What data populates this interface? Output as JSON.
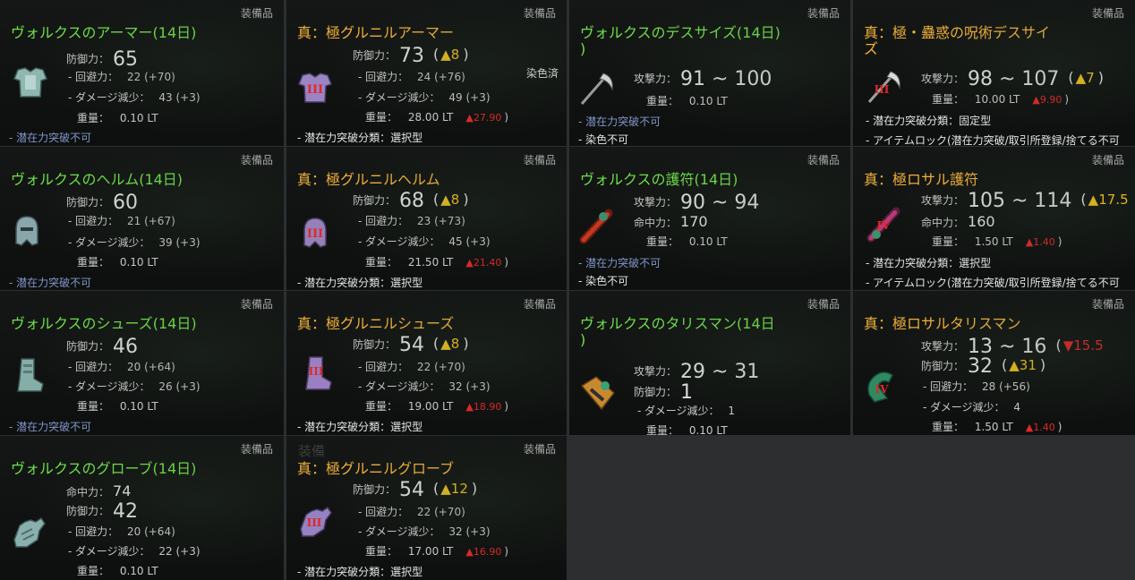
{
  "common": {
    "equip_label": "装備品",
    "defense_label": "防御力：",
    "evasion_label": "- 回避力：",
    "dmgred_label": "- ダメージ減少：",
    "weight_label": "重量：",
    "attack_label": "攻撃力：",
    "accuracy_label": "命中力：",
    "potential_no": "- 潜在力突破不可",
    "potential_select": "- 潜在力突破分類：選択型",
    "potential_fixed": "- 潜在力突破分類：固定型",
    "item_lock": "- アイテムロック(潜在力突破/取引所登録/捨てる不可",
    "dye_no": "- 染色不可",
    "dye_done": "染色済",
    "ghost_text": "装備"
  },
  "armor": {
    "vol_armor": {
      "title": "ヴォルクスのアーマー(14日)",
      "defense": "65",
      "evasion": "22 (+70)",
      "dmgred": "43 (+3)",
      "weight": "0.10 LT"
    },
    "gru_armor": {
      "title": "真：極グルニルアーマー",
      "defense": "73",
      "up": "▲8",
      "up_close": ")",
      "evasion": "24 (+76)",
      "dmgred": "49 (+3)",
      "weight": "28.00 LT",
      "weight_diff": "▲27.90",
      "numeral": "III"
    },
    "vol_helm": {
      "title": "ヴォルクスのヘルム(14日)",
      "defense": "60",
      "evasion": "21 (+67)",
      "dmgred": "39 (+3)",
      "weight": "0.10 LT"
    },
    "gru_helm": {
      "title": "真：極グルニルヘルム",
      "defense": "68",
      "up": "▲8",
      "up_close": ")",
      "evasion": "23 (+73)",
      "dmgred": "45 (+3)",
      "weight": "21.50 LT",
      "weight_diff": "▲21.40",
      "numeral": "III"
    },
    "vol_shoes": {
      "title": "ヴォルクスのシューズ(14日)",
      "defense": "46",
      "evasion": "20 (+64)",
      "dmgred": "26 (+3)",
      "weight": "0.10 LT"
    },
    "gru_shoes": {
      "title": "真：極グルニルシューズ",
      "defense": "54",
      "up": "▲8",
      "up_close": ")",
      "evasion": "22 (+70)",
      "dmgred": "32 (+3)",
      "weight": "19.00 LT",
      "weight_diff": "▲18.90",
      "numeral": "III"
    },
    "vol_glove": {
      "title": "ヴォルクスのグローブ(14日)",
      "accuracy": "74",
      "defense": "42",
      "evasion": "20 (+64)",
      "dmgred": "22 (+3)",
      "weight": "0.10 LT"
    },
    "gru_glove": {
      "title": "真：極グルニルグローブ",
      "defense": "54",
      "up": "▲12",
      "up_close": ")",
      "evasion": "22 (+70)",
      "dmgred": "32 (+3)",
      "weight": "17.00 LT",
      "weight_diff": "▲16.90",
      "numeral": "III"
    }
  },
  "weapons": {
    "vol_scythe": {
      "title": "ヴォルクスのデスサイズ(14日)",
      "title2": ")",
      "attack": "91 ~ 100",
      "weight": "0.10 LT"
    },
    "kyoku_scythe": {
      "title": "真：極・蠱惑の呪術デスサイ",
      "title2": "ズ",
      "attack": "98 ~ 107",
      "up": "▲7",
      "up_close": ")",
      "weight": "10.00 LT",
      "weight_diff": "▲9.90",
      "numeral": "III"
    },
    "vol_amulet": {
      "title": "ヴォルクスの護符(14日)",
      "attack": "90 ~ 94",
      "accuracy": "170",
      "weight": "0.10 LT"
    },
    "kyoku_amulet": {
      "title": "真：極ロサル護符",
      "attack": "105 ~ 114",
      "up": "▲17.5",
      "accuracy": "160",
      "weight": "1.50 LT",
      "weight_diff": "▲1.40",
      "numeral": "IV"
    },
    "vol_talisman": {
      "title": "ヴォルクスのタリスマン(14日",
      "title2": ")",
      "attack": "29 ~ 31",
      "defense": "1",
      "dmgred": "1",
      "weight": "0.10 LT"
    },
    "kyoku_talisman": {
      "title": "真：極ロサルタリスマン",
      "attack": "13 ~ 16",
      "down": "▼15.5",
      "defense": "32",
      "up": "▲31",
      "up_close": ")",
      "evasion": "28 (+56)",
      "dmgred": "4",
      "weight": "1.50 LT",
      "weight_diff": "▲1.40",
      "numeral": "IV"
    }
  },
  "colors": {
    "green_title": "#6fe14a",
    "gold_title": "#f3b13a",
    "up": "#f2c41d",
    "down": "#e02828",
    "blue_note": "#7f95c8"
  },
  "icons": [
    "armor-icon",
    "helm-icon",
    "shoes-icon",
    "glove-icon",
    "scythe-icon",
    "amulet-icon",
    "talisman-icon"
  ]
}
